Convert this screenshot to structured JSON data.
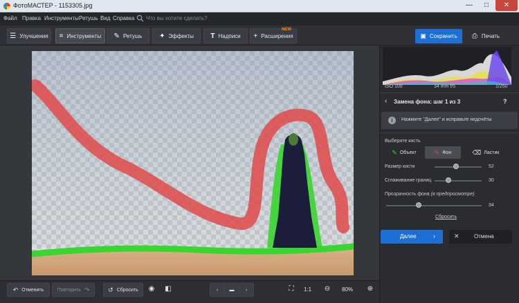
{
  "window": {
    "title": "ФотоМАСТЕР - 1153305.jpg",
    "min": "—",
    "max": "□",
    "close": "✕"
  },
  "menu": {
    "items": [
      "Файл",
      "Правка",
      "Инструменты",
      "Ретушь",
      "Вид",
      "Справка"
    ],
    "search_placeholder": "Что вы хотите сделать?"
  },
  "tabs": [
    {
      "label": "Улучшения",
      "icon": "sliders-icon"
    },
    {
      "label": "Инструменты",
      "icon": "crop-icon",
      "active": true
    },
    {
      "label": "Ретушь",
      "icon": "brush-icon"
    },
    {
      "label": "Эффекты",
      "icon": "magic-wand-icon"
    },
    {
      "label": "Надписи",
      "icon": "text-icon"
    },
    {
      "label": "Расширения",
      "icon": "plus-icon",
      "badge": "NEW"
    }
  ],
  "actions": {
    "save": "Сохранить",
    "print": "Печать"
  },
  "histogram": {
    "iso": "ISO 100",
    "lens": "34 mm f/5",
    "shutter": "1/250"
  },
  "panel": {
    "step_title": "Замена фона: шаг 1 из 3",
    "help": "?",
    "hint": "Нажмите \"Далее\" и исправьте недочёты",
    "brush_title": "Выберите кисть",
    "brushes": [
      "Объект",
      "Фон",
      "Ластик"
    ],
    "selected_brush": "Фон",
    "sliders": [
      {
        "label": "Размер кисти",
        "value": 52,
        "fraction": 0.45
      },
      {
        "label": "Сглаживание границ",
        "value": 30,
        "fraction": 0.3
      },
      {
        "label": "Прозрачность фона",
        "note": "(в предпросмотре)",
        "value": 34,
        "fraction": 0.34
      }
    ],
    "reset": "Сбросить",
    "next": "Далее",
    "cancel": "Отмена"
  },
  "bottom": {
    "undo": "Отменить",
    "redo": "Повторить",
    "reset": "Сбросить",
    "zoom_fit": "1:1",
    "zoom": "80%"
  },
  "colors": {
    "accent": "#1d6fd6",
    "object_brush": "#22cc22",
    "background_brush": "#e04a4a",
    "new_badge": "#ff8a1f"
  }
}
